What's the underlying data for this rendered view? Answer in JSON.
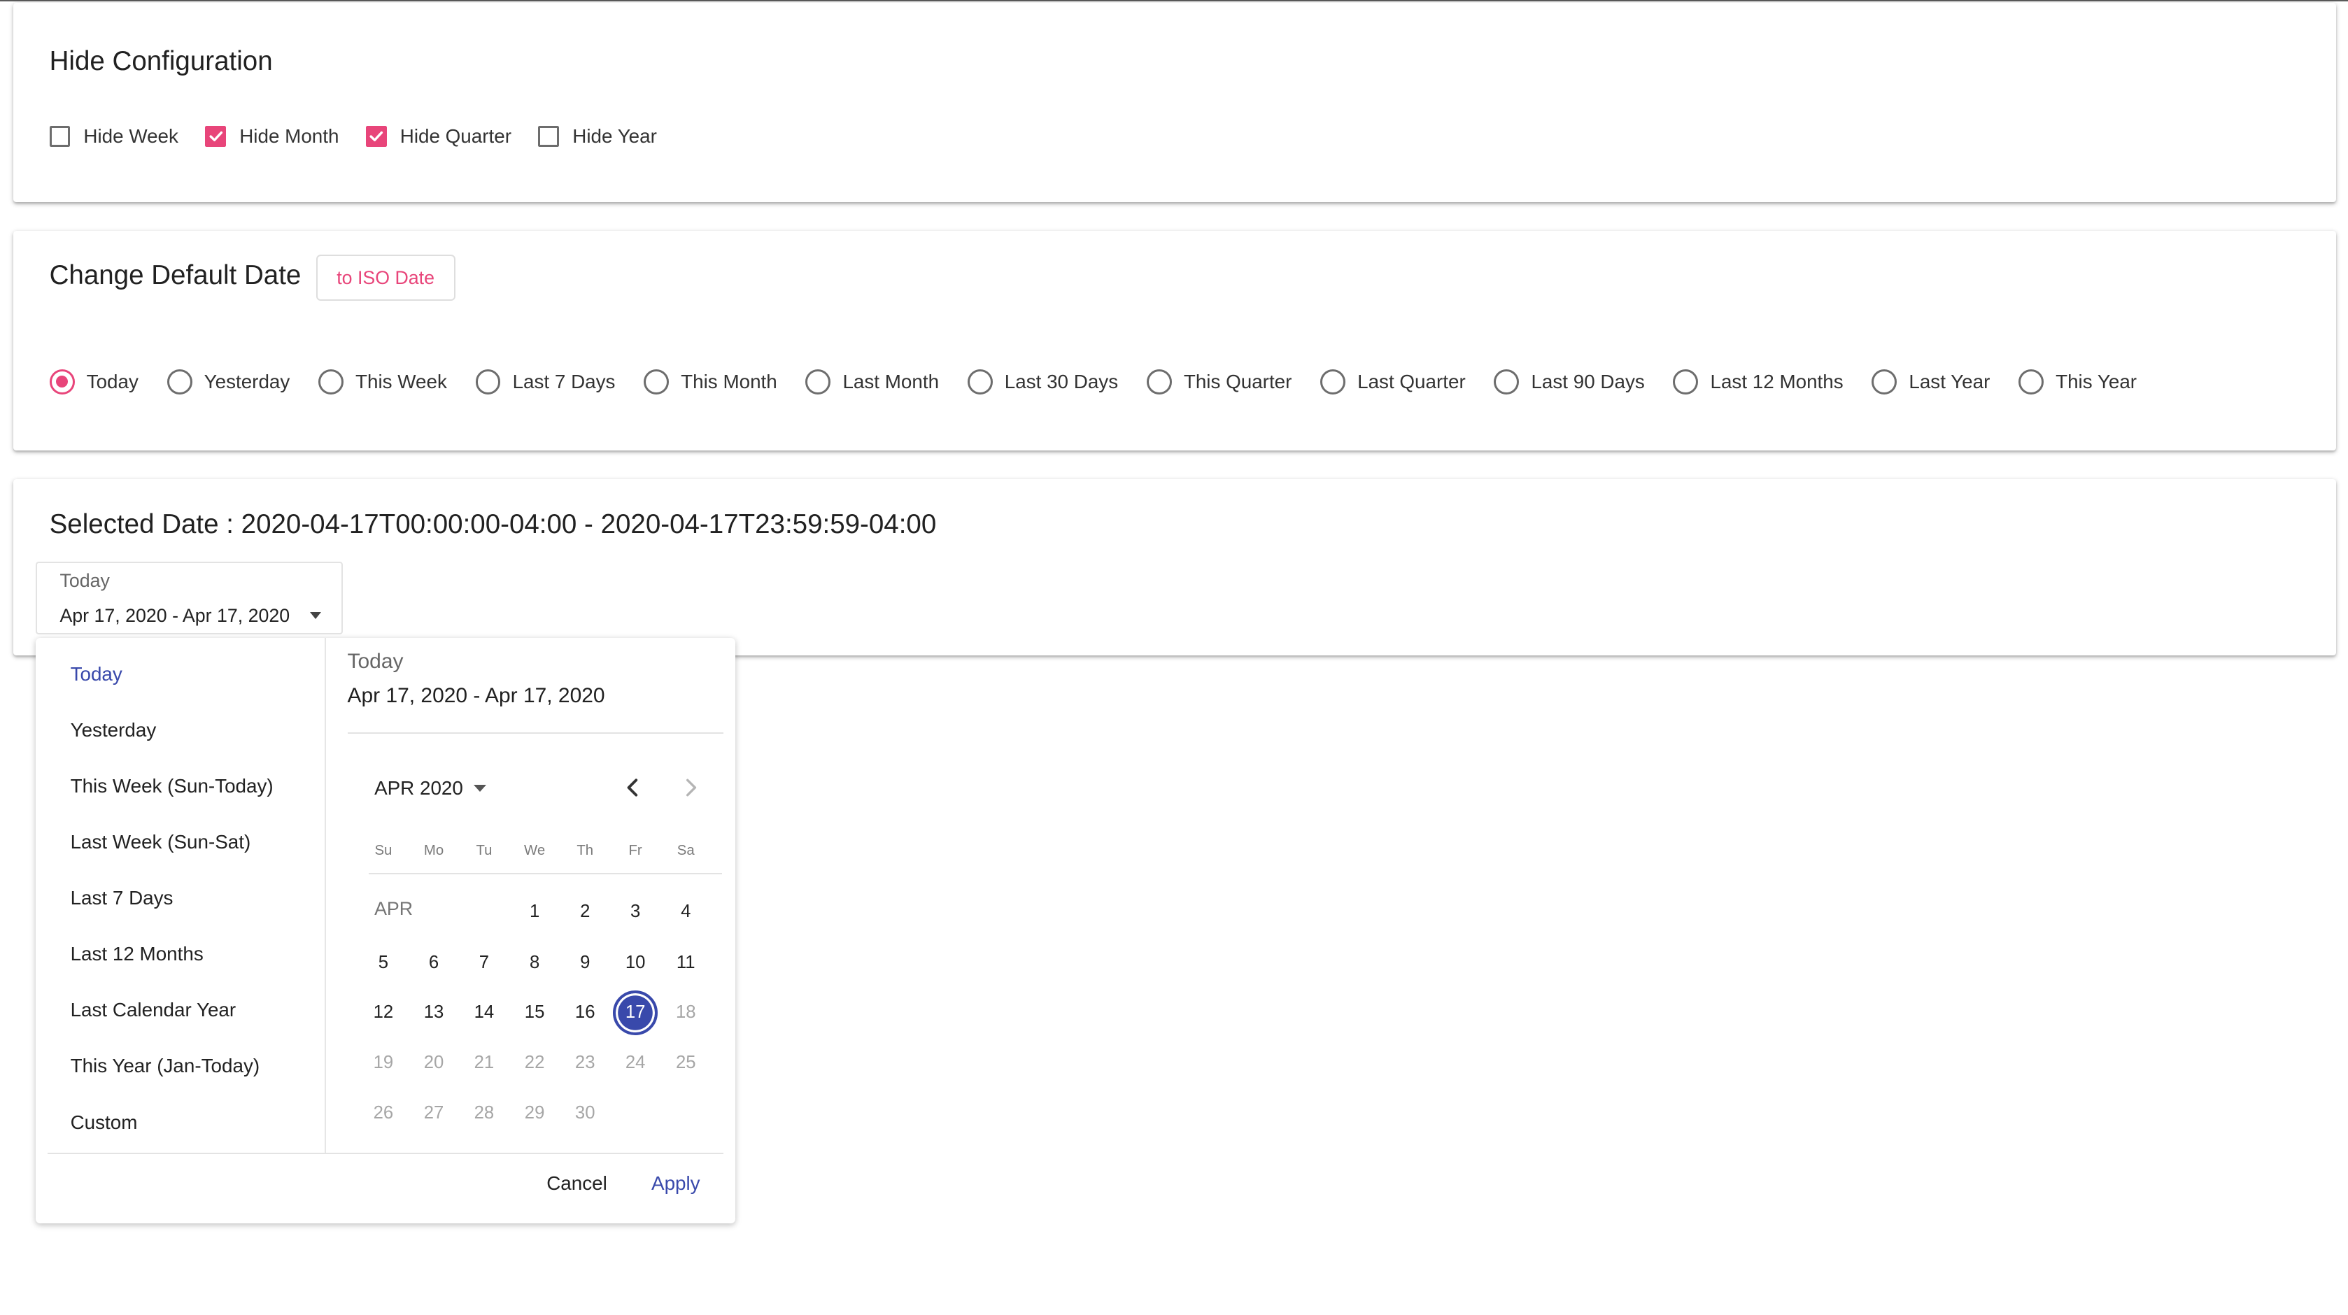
{
  "hide_config": {
    "title": "Hide Configuration",
    "options": [
      {
        "label": "Hide Week",
        "checked": false
      },
      {
        "label": "Hide Month",
        "checked": true
      },
      {
        "label": "Hide Quarter",
        "checked": true
      },
      {
        "label": "Hide Year",
        "checked": false
      }
    ]
  },
  "default_date": {
    "title": "Change Default Date",
    "iso_button": "to ISO Date",
    "options": [
      {
        "label": "Today",
        "selected": true
      },
      {
        "label": "Yesterday",
        "selected": false
      },
      {
        "label": "This Week",
        "selected": false
      },
      {
        "label": "Last 7 Days",
        "selected": false
      },
      {
        "label": "This Month",
        "selected": false
      },
      {
        "label": "Last Month",
        "selected": false
      },
      {
        "label": "Last 30 Days",
        "selected": false
      },
      {
        "label": "This Quarter",
        "selected": false
      },
      {
        "label": "Last Quarter",
        "selected": false
      },
      {
        "label": "Last 90 Days",
        "selected": false
      },
      {
        "label": "Last 12 Months",
        "selected": false
      },
      {
        "label": "Last Year",
        "selected": false
      },
      {
        "label": "This Year",
        "selected": false
      }
    ]
  },
  "selected": {
    "title": "Selected Date : 2020-04-17T00:00:00-04:00 - 2020-04-17T23:59:59-04:00",
    "field_label": "Today",
    "field_value": "Apr 17, 2020 - Apr 17, 2020"
  },
  "picker": {
    "presets": [
      "Today",
      "Yesterday",
      "This Week (Sun-Today)",
      "Last Week (Sun-Sat)",
      "Last 7 Days",
      "Last 12 Months",
      "Last Calendar Year",
      "This Year (Jan-Today)",
      "Custom"
    ],
    "active_preset": "Today",
    "preview_label": "Today",
    "preview_value": "Apr 17, 2020 - Apr 17, 2020",
    "month_title": "APR 2020",
    "month_short": "APR",
    "weekdays": [
      "Su",
      "Mo",
      "Tu",
      "We",
      "Th",
      "Fr",
      "Sa"
    ],
    "first_weekday": 3,
    "days_in_month": 30,
    "selected_day": 17,
    "max_day": 17,
    "cancel": "Cancel",
    "apply": "Apply"
  },
  "colors": {
    "accent": "#e8457a",
    "primary": "#3949ab"
  },
  "icons": {
    "prev_month": "chevron-left-icon",
    "next_month": "chevron-right-icon",
    "month_dropdown": "caret-down-icon",
    "field_dropdown": "caret-down-icon",
    "checkbox_check": "check-icon"
  }
}
